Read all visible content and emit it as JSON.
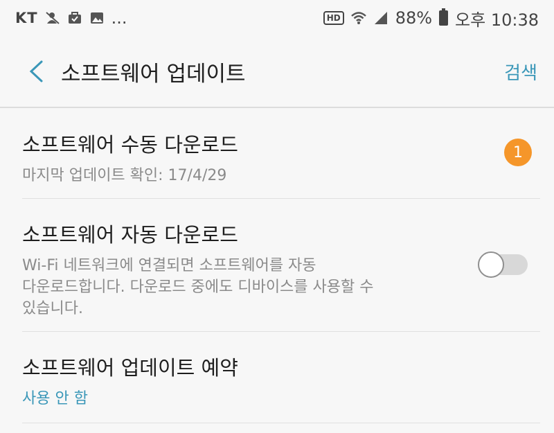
{
  "status_bar": {
    "carrier": "KT",
    "more": "...",
    "battery_percent": "88%",
    "time": "오후 10:38",
    "hd": "HD",
    "icons": [
      "silent-icon",
      "briefcase-icon",
      "image-icon",
      "hd-voice-icon",
      "wifi-icon",
      "signal-icon",
      "battery-icon"
    ]
  },
  "appbar": {
    "title": "소프트웨어 업데이트",
    "search_label": "검색"
  },
  "items": [
    {
      "title": "소프트웨어 수동 다운로드",
      "subtitle": "마지막 업데이트 확인: 17/4/29",
      "badge": "1"
    },
    {
      "title": "소프트웨어 자동 다운로드",
      "subtitle_lines": [
        "Wi-Fi 네트워크에 연결되면 소프트웨어를 자동",
        "다운로드합니다. 다운로드 중에도 디바이스를 사용할 수",
        "있습니다."
      ],
      "toggle_on": false
    },
    {
      "title": "소프트웨어 업데이트 예약",
      "subtitle": "사용 안 함"
    }
  ],
  "colors": {
    "accent": "#3a97b8",
    "badge": "#f5962a",
    "background": "#f7f7f7"
  }
}
